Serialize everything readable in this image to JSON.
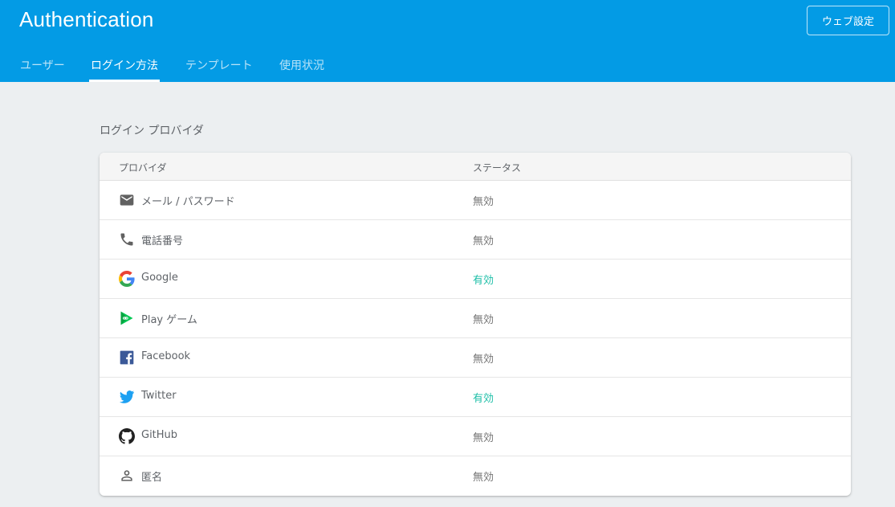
{
  "header": {
    "title": "Authentication",
    "web_settings_label": "ウェブ設定",
    "tabs": [
      {
        "label": "ユーザー",
        "active": false
      },
      {
        "label": "ログイン方法",
        "active": true
      },
      {
        "label": "テンプレート",
        "active": false
      },
      {
        "label": "使用状況",
        "active": false
      }
    ],
    "color": "#039be5"
  },
  "main": {
    "section_title": "ログイン プロバイダ",
    "table": {
      "columns": [
        "プロバイダ",
        "ステータス"
      ],
      "rows": [
        {
          "icon": "email-icon",
          "provider": "メール / パスワード",
          "status": "無効",
          "enabled": false
        },
        {
          "icon": "phone-icon",
          "provider": "電話番号",
          "status": "無効",
          "enabled": false
        },
        {
          "icon": "google-icon",
          "provider": "Google",
          "status": "有効",
          "enabled": true
        },
        {
          "icon": "play-games-icon",
          "provider": "Play ゲーム",
          "status": "無効",
          "enabled": false
        },
        {
          "icon": "facebook-icon",
          "provider": "Facebook",
          "status": "無効",
          "enabled": false
        },
        {
          "icon": "twitter-icon",
          "provider": "Twitter",
          "status": "有効",
          "enabled": true
        },
        {
          "icon": "github-icon",
          "provider": "GitHub",
          "status": "無効",
          "enabled": false
        },
        {
          "icon": "anonymous-person-icon",
          "provider": "匿名",
          "status": "無効",
          "enabled": false
        }
      ]
    },
    "status_enabled_color": "#1fbfa8"
  }
}
